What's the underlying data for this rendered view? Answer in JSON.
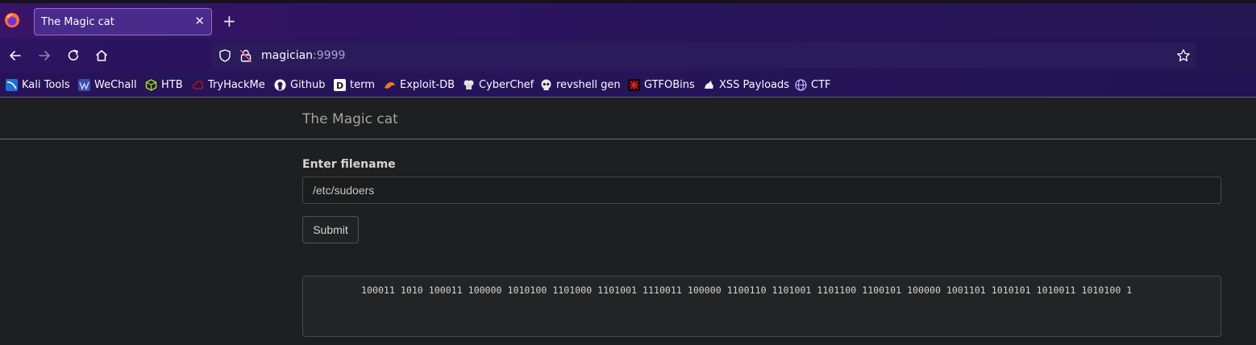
{
  "browser": {
    "tab": {
      "title": "The Magic cat",
      "close_glyph": "✕"
    },
    "new_tab_glyph": "+",
    "url": {
      "host": "magician",
      "port": ":9999"
    },
    "bookmarks": [
      {
        "label": "Kali Tools",
        "icon": "kali-icon"
      },
      {
        "label": "WeChall",
        "icon": "wechall-icon"
      },
      {
        "label": "HTB",
        "icon": "htb-icon"
      },
      {
        "label": "TryHackMe",
        "icon": "tryhackme-icon"
      },
      {
        "label": "Github",
        "icon": "github-icon"
      },
      {
        "label": "term",
        "icon": "term-icon"
      },
      {
        "label": "Exploit-DB",
        "icon": "exploitdb-icon"
      },
      {
        "label": "CyberChef",
        "icon": "cyberchef-icon"
      },
      {
        "label": "revshell gen",
        "icon": "skull-icon"
      },
      {
        "label": "GTFOBins",
        "icon": "gtfobins-icon"
      },
      {
        "label": "XSS Payloads",
        "icon": "xss-icon"
      },
      {
        "label": "CTF",
        "icon": "globe-icon"
      }
    ]
  },
  "page": {
    "brand": "The Magic cat",
    "form": {
      "label": "Enter filename",
      "filename_value": "/etc/sudoers",
      "submit_label": "Submit"
    },
    "output": "100011 1010 100011 100000 1010100 1101000 1101001 1110011 100000 1100110 1101001 1101100 1100101 100000 1001101 1010101 1010011 1010100 1"
  },
  "colors": {
    "tab_bg": "#4a2b8c",
    "toolbar_bg": "#2c1460",
    "page_bg": "#1e1f20",
    "input_border": "#45484c"
  }
}
